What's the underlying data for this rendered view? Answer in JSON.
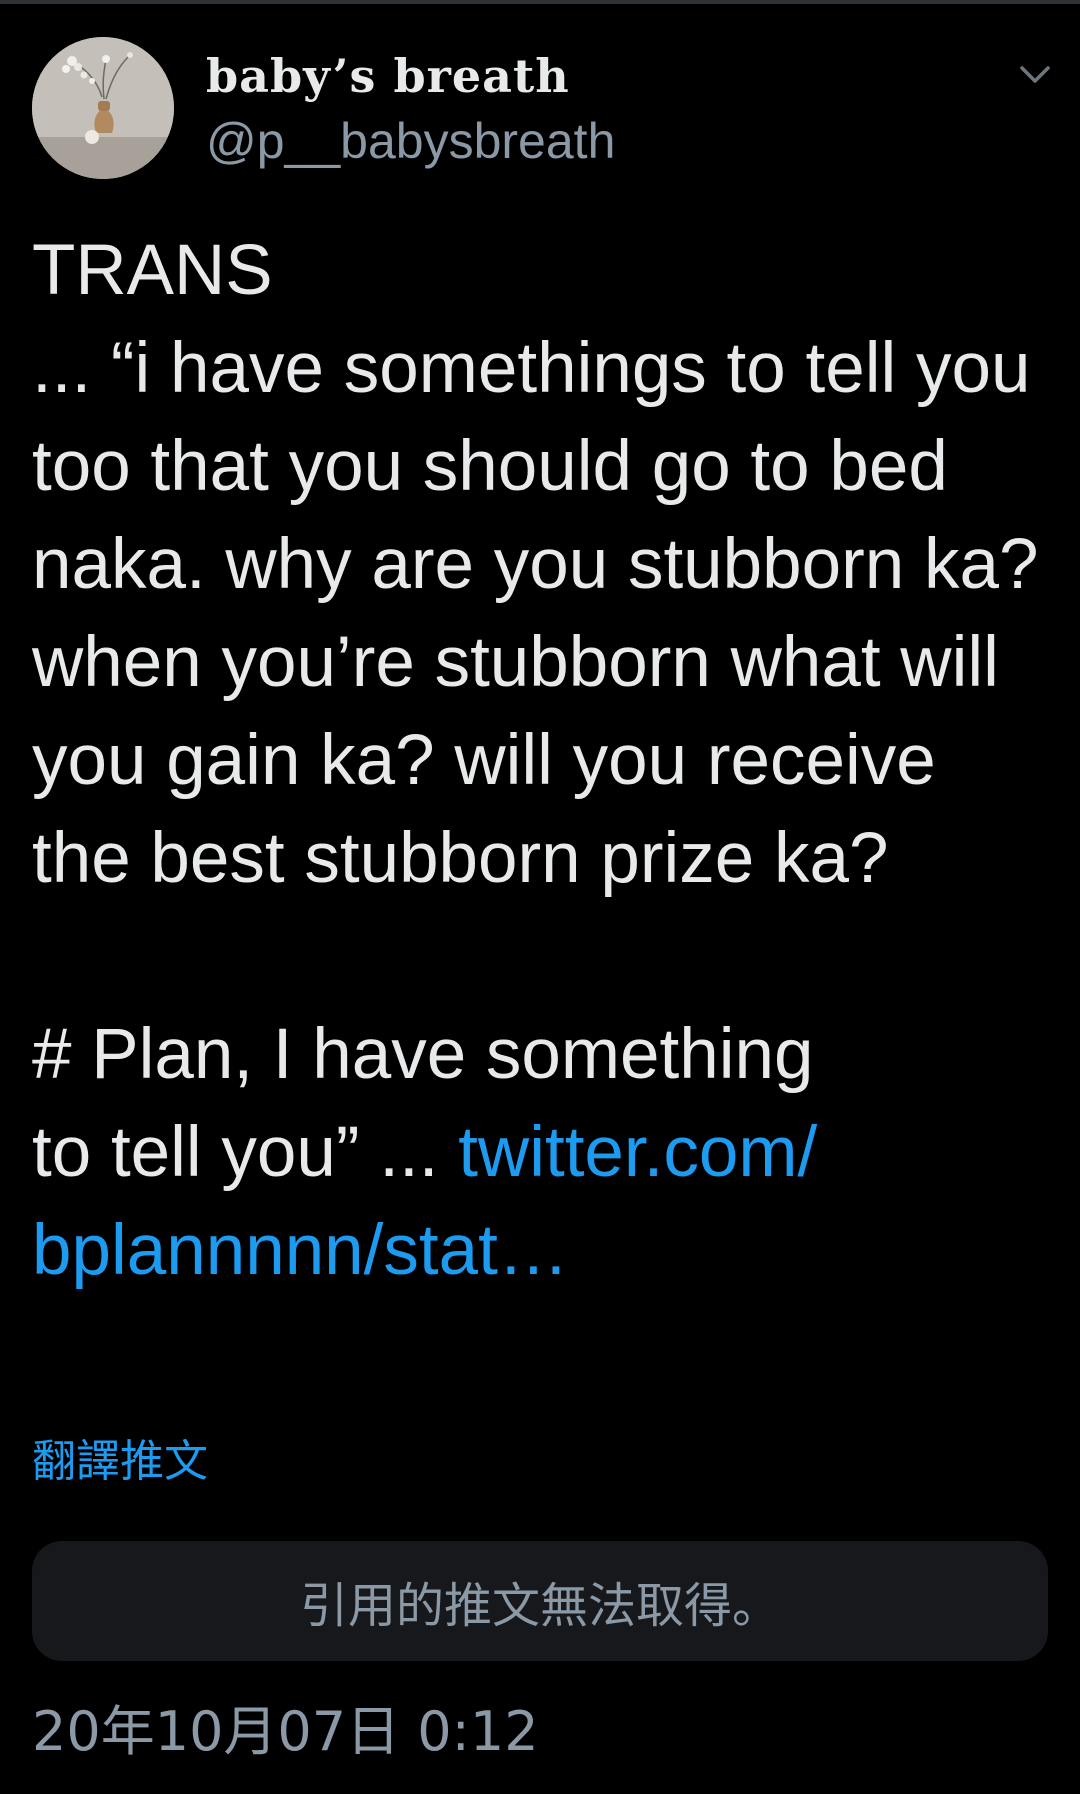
{
  "tweet": {
    "author": {
      "display_name": "baby’s breath",
      "handle": "@p__babysbreath",
      "avatar_icon": "avatar-photo-flowers-in-vase"
    },
    "menu_icon": "chevron-down-icon",
    "text_main": "TRANS\n... “i have somethings to tell you too that you should go to bed naka. why are you stubborn ka? when you’re stubborn what will you gain ka? will you receive the best stubborn prize ka?\n\n# Plan, I have something\nto tell you” ... ",
    "link_text": "twitter.com/\nbplannnnn/stat…",
    "translate_label": "翻譯推文",
    "quoted_unavailable": "引用的推文無法取得。",
    "timestamp": "20年10月07日 0:12"
  },
  "colors": {
    "background": "#000000",
    "text_primary": "#e7e9ea",
    "text_secondary": "#8b98a5",
    "accent_link": "#1d9bf0",
    "card_background": "#16181c"
  }
}
